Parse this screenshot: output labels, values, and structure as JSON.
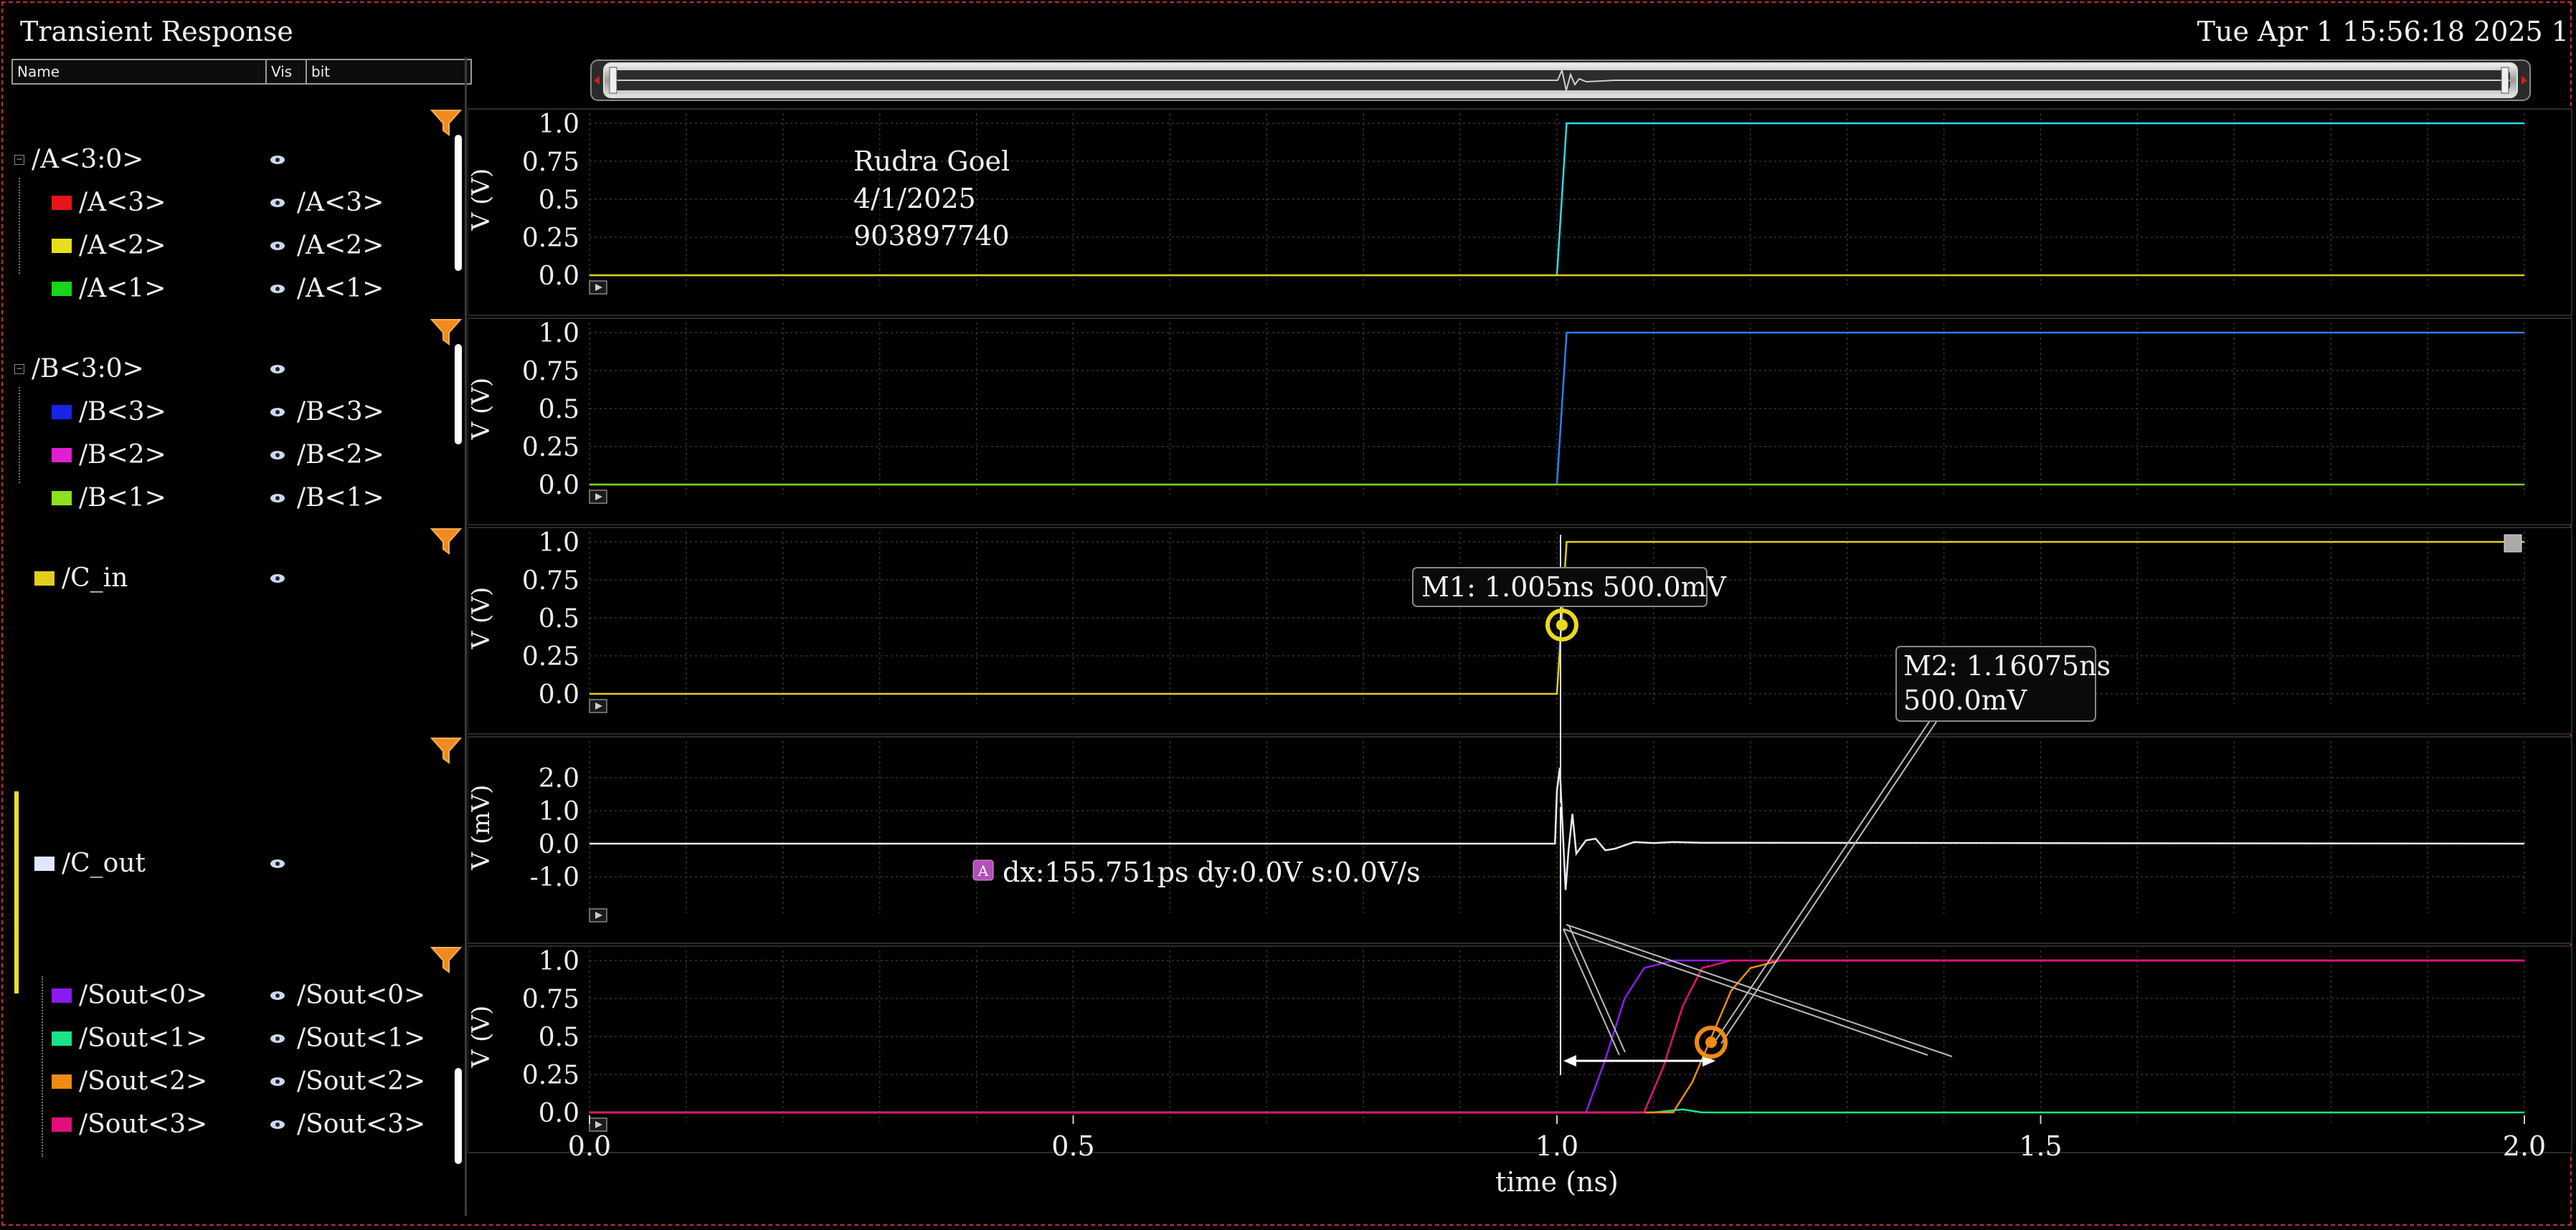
{
  "window": {
    "title": "Transient Response",
    "datetime": "Tue Apr 1 15:56:18 2025  1"
  },
  "panel": {
    "headers": {
      "name": "Name",
      "vis": "Vis",
      "bit": "bit"
    },
    "groups": [
      {
        "label": "/A<3:0>",
        "children": [
          {
            "name": "/A<3>",
            "bit": "/A<3>",
            "color": "#e8141a"
          },
          {
            "name": "/A<2>",
            "bit": "/A<2>",
            "color": "#e6e01c"
          },
          {
            "name": "/A<1>",
            "bit": "/A<1>",
            "color": "#18d41c"
          }
        ]
      },
      {
        "label": "/B<3:0>",
        "children": [
          {
            "name": "/B<3>",
            "bit": "/B<3>",
            "color": "#1a24e6"
          },
          {
            "name": "/B<2>",
            "bit": "/B<2>",
            "color": "#e01ed2"
          },
          {
            "name": "/B<1>",
            "bit": "/B<1>",
            "color": "#8ce020"
          }
        ]
      },
      {
        "label": "/C_in",
        "color": "#e0d018"
      },
      {
        "label": "/C_out",
        "color": "#dfe8ff"
      },
      {
        "children": [
          {
            "name": "/Sout<0>",
            "bit": "/Sout<0>",
            "color": "#8a1cf0"
          },
          {
            "name": "/Sout<1>",
            "bit": "/Sout<1>",
            "color": "#1ce28a"
          },
          {
            "name": "/Sout<2>",
            "bit": "/Sout<2>",
            "color": "#f08a14"
          },
          {
            "name": "/Sout<3>",
            "bit": "/Sout<3>",
            "color": "#e2107a"
          }
        ]
      }
    ]
  },
  "annotation": {
    "author": "Rudra Goel",
    "date": "4/1/2025",
    "id": "903897740"
  },
  "markers": {
    "m1": "M1: 1.005ns 500.0mV",
    "m2_line1": "M2: 1.16075ns",
    "m2_line2": "500.0mV",
    "delta_badge": "A",
    "delta": "dx:155.751ps dy:0.0V s:0.0V/s"
  },
  "chart_data": {
    "type": "line",
    "xlabel": "time (ns)",
    "xlim": [
      0,
      2.0
    ],
    "xticks": [
      "0.0",
      "0.5",
      "1.0",
      "1.5",
      "2.0"
    ],
    "subplots": [
      {
        "ylabel": "V (V)",
        "yticks": [
          "1.0",
          "0.75",
          "0.5",
          "0.25",
          "0.0"
        ],
        "ylim": [
          0,
          1.0
        ],
        "series": [
          {
            "color": "#30d8e0",
            "x": [
              0,
              1.0,
              1.01,
              2.0
            ],
            "y": [
              0,
              0,
              1.0,
              1.0
            ]
          },
          {
            "color": "#d8c820",
            "x": [
              0,
              2.0
            ],
            "y": [
              0,
              0
            ]
          }
        ]
      },
      {
        "ylabel": "V (V)",
        "yticks": [
          "1.0",
          "0.75",
          "0.5",
          "0.25",
          "0.0"
        ],
        "ylim": [
          0,
          1.0
        ],
        "series": [
          {
            "color": "#2a80f0",
            "x": [
              0,
              1.0,
              1.01,
              2.0
            ],
            "y": [
              0,
              0,
              1.0,
              1.0
            ]
          },
          {
            "color": "#7ad020",
            "x": [
              0,
              2.0
            ],
            "y": [
              0,
              0
            ]
          }
        ]
      },
      {
        "ylabel": "V (V)",
        "yticks": [
          "1.0",
          "0.75",
          "0.5",
          "0.25",
          "0.0"
        ],
        "ylim": [
          0,
          1.0
        ],
        "series": [
          {
            "color": "#e0d018",
            "x": [
              0,
              1.0,
              1.01,
              2.0
            ],
            "y": [
              0,
              0,
              1.0,
              1.0
            ]
          }
        ]
      },
      {
        "ylabel": "V (mV)",
        "yticks": [
          "2.0",
          "1.0",
          "0.0",
          "-1.0"
        ],
        "ylim": [
          -1.8,
          2.8
        ],
        "series": [
          {
            "color": "#e8ecf4",
            "x": [
              0,
              0.998,
              1.0,
              1.003,
              1.006,
              1.009,
              1.012,
              1.016,
              1.02,
              1.03,
              1.04,
              1.05,
              1.06,
              1.07,
              1.08,
              1.1,
              1.12,
              1.15,
              2.0
            ],
            "y": [
              0,
              0,
              1.6,
              2.3,
              0.4,
              -1.4,
              -0.2,
              0.9,
              -0.3,
              0.1,
              0.15,
              -0.2,
              -0.15,
              -0.05,
              0.05,
              0.02,
              0.05,
              0.03,
              0
            ]
          }
        ]
      },
      {
        "ylabel": "V (V)",
        "yticks": [
          "1.0",
          "0.75",
          "0.5",
          "0.25",
          "0.0"
        ],
        "ylim": [
          0,
          1.0
        ],
        "series": [
          {
            "color": "#8a1cf0",
            "x": [
              0,
              1.03,
              1.05,
              1.07,
              1.09,
              1.12,
              2.0
            ],
            "y": [
              0,
              0,
              0.35,
              0.75,
              0.95,
              1.0,
              1.0
            ]
          },
          {
            "color": "#1ce28a",
            "x": [
              0,
              1.1,
              1.13,
              1.15,
              2.0
            ],
            "y": [
              0,
              0,
              0.02,
              0,
              0
            ]
          },
          {
            "color": "#f08a14",
            "x": [
              0,
              1.12,
              1.14,
              1.16,
              1.18,
              1.2,
              1.23,
              2.0
            ],
            "y": [
              0,
              0,
              0.2,
              0.5,
              0.8,
              0.95,
              1.0,
              1.0
            ]
          },
          {
            "color": "#e2107a",
            "x": [
              0,
              1.09,
              1.11,
              1.13,
              1.15,
              1.18,
              2.0
            ],
            "y": [
              0,
              0,
              0.3,
              0.7,
              0.95,
              1.0,
              1.0
            ]
          }
        ]
      }
    ]
  }
}
